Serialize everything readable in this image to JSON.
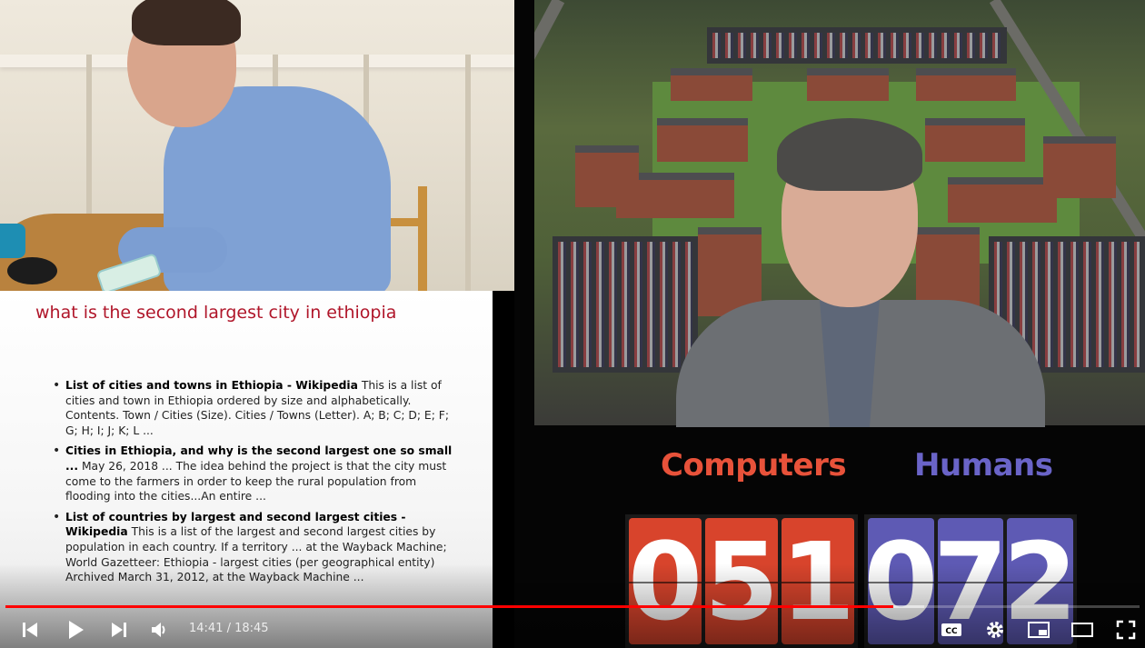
{
  "slide": {
    "query": "what is the second largest city in ethiopia",
    "results": [
      {
        "title": "List of cities and towns in Ethiopia - Wikipedia",
        "snippet": "This is a list of cities and town in Ethiopia ordered by size and alphabetically. Contents. Town / Cities (Size). Cities / Towns (Letter). A; B; C; D; E; F; G; H; I; J; K; L ..."
      },
      {
        "title": "Cities in Ethiopia, and why is the second largest one so small ...",
        "snippet": "May 26, 2018 ... The idea behind the project is that the city must come to the farmers in order to keep the rural population from flooding into the cities...An entire ..."
      },
      {
        "title": "List of countries by largest and second largest cities - Wikipedia",
        "snippet": "This is a list of the largest and second largest cities by population in each country. If a territory ... at the Wayback Machine; World Gazetteer: Ethiopia - largest cities (per geographical entity) Archived March 31, 2012, at the Wayback Machine ..."
      }
    ]
  },
  "scoreboard": {
    "computers": {
      "label": "Computers",
      "digits": [
        "0",
        "5",
        "1"
      ],
      "color": "#e8523a"
    },
    "humans": {
      "label": "Humans",
      "digits": [
        "0",
        "7",
        "2"
      ],
      "color": "#6a64c8"
    }
  },
  "player": {
    "current_time": "14:41",
    "duration": "18:45",
    "time_display": "14:41 / 18:45",
    "progress_fraction": 0.783,
    "buffered_fraction": 0.81,
    "accent_color": "#ff0000",
    "icons": {
      "prev": "skip-previous-icon",
      "play": "play-icon",
      "next": "skip-next-icon",
      "volume": "volume-icon",
      "captions": "closed-captions-icon",
      "settings": "gear-icon",
      "miniplayer": "miniplayer-icon",
      "theater": "theater-mode-icon",
      "fullscreen": "fullscreen-icon"
    }
  }
}
